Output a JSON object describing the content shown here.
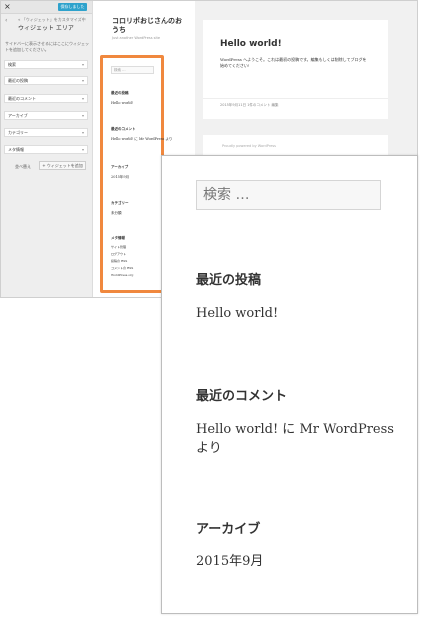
{
  "customizer": {
    "close_label": "×",
    "saved_button": "保存しました",
    "back_arrow": "‹",
    "breadcrumb": "« 「ウィジェット」をカスタマイズ中",
    "area_title": "ウィジェット エリア",
    "description": "サイドバーに表示させるにはここにウィジェットを追加してください。",
    "widgets": [
      "検索",
      "最近の投稿",
      "最近のコメント",
      "アーカイブ",
      "カテゴリー",
      "メタ情報"
    ],
    "reorder_label": "並べ替え",
    "add_widget_label": "+ ウィジェットを追加"
  },
  "site": {
    "title": "コロリポおじさんのおうち",
    "tagline": "Just another WordPress site"
  },
  "mini_sidebar": {
    "search_placeholder": "検索 …",
    "recent_posts_heading": "最近の投稿",
    "recent_post": "Hello world!",
    "recent_comments_heading": "最近のコメント",
    "recent_comment": "Hello world! に Mr WordPress より",
    "archive_heading": "アーカイブ",
    "archive_item": "2015年9月",
    "category_heading": "カテゴリー",
    "category_item": "未分類",
    "meta_heading": "メタ情報",
    "meta_items": [
      "サイト管理",
      "ログアウト",
      "投稿の RSS",
      "コメントの RSS",
      "WordPress.org"
    ]
  },
  "post": {
    "title": "Hello world!",
    "body": "WordPress へようこそ。これは最初の投稿です。編集もしくは削除してブログを始めてください!",
    "meta": "2015年9月11日  1件のコメント  編集"
  },
  "footer": {
    "text": "Proudly powered by WordPress"
  },
  "zoom": {
    "search_placeholder": "検索 …",
    "recent_posts_heading": "最近の投稿",
    "recent_post": "Hello world!",
    "recent_comments_heading": "最近のコメント",
    "recent_comment_line1": "Hello world! に Mr WordPress",
    "recent_comment_line2": "より",
    "archive_heading": "アーカイブ",
    "archive_item": "2015年9月"
  },
  "colors": {
    "accent": "#2ea2cc",
    "highlight": "#f0883e"
  }
}
